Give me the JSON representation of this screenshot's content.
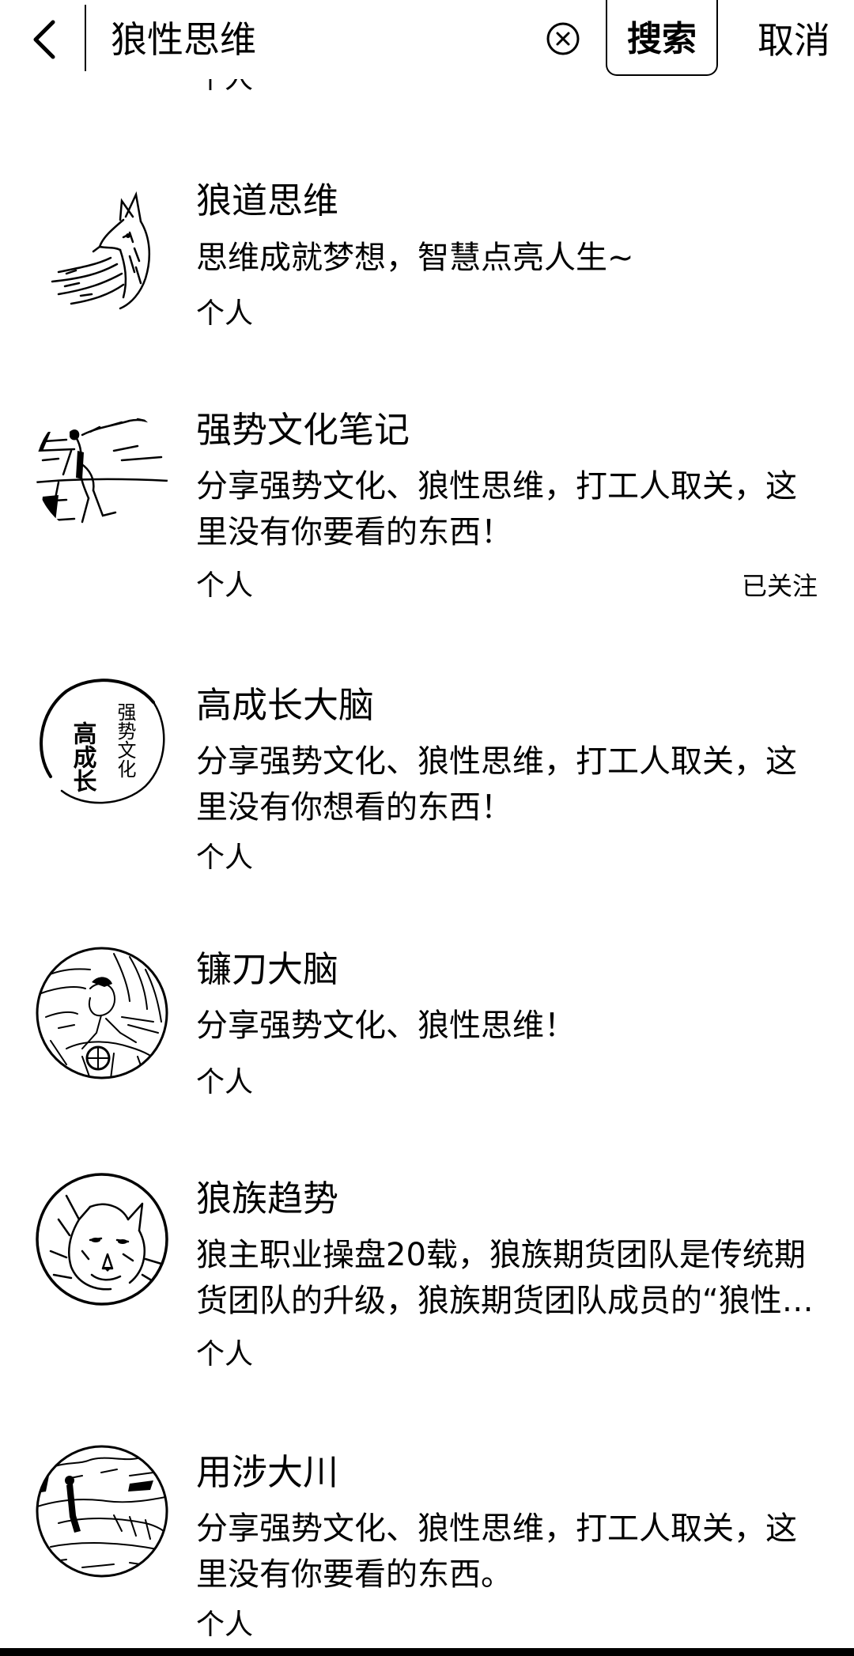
{
  "header": {
    "search_value": "狼性思维",
    "search_button": "搜索",
    "cancel_button": "取消",
    "icons": {
      "back": "chevron-left-icon",
      "clear": "clear-circle-icon"
    }
  },
  "previous_item_partial": "个人",
  "results": [
    {
      "name": "狼道思维",
      "desc_lines": [
        "思维成就梦想，智慧点亮人生~"
      ],
      "type": "个人",
      "avatar": "fox-sketch-avatar"
    },
    {
      "name": "强势文化笔记",
      "desc_lines": [
        "分享强势文化、狼性思维，打工人取关，这",
        "里没有你要看的东西！"
      ],
      "type": "个人",
      "follow_status": "已关注",
      "avatar": "climber-sketch-avatar"
    },
    {
      "name": "高成长大脑",
      "desc_lines": [
        "分享强势文化、狼性思维，打工人取关，这",
        "里没有你想看的东西！"
      ],
      "type": "个人",
      "avatar": "calligraphy-circle-avatar",
      "avatar_text": {
        "main": "高成长",
        "side": "强势文化"
      }
    },
    {
      "name": "镰刀大脑",
      "desc_lines": [
        "分享强势文化、狼性思维！"
      ],
      "type": "个人",
      "avatar": "engraving-circle-avatar"
    },
    {
      "name": "狼族趋势",
      "desc_lines": [
        "狼主职业操盘20载，狼族期货团队是传统期",
        "货团队的升级，狼族期货团队成员的“狼性…"
      ],
      "type": "个人",
      "avatar": "wolf-circle-avatar"
    },
    {
      "name": "用涉大川",
      "desc_lines": [
        "分享强势文化、狼性思维，打工人取关，这",
        "里没有你要看的东西。"
      ],
      "type": "个人",
      "avatar": "landscape-circle-avatar"
    }
  ]
}
